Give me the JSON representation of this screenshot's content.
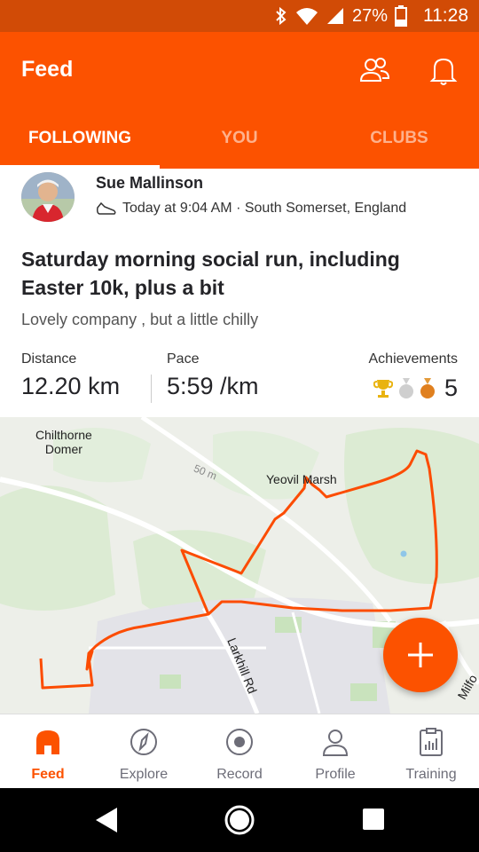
{
  "status_bar": {
    "battery_percent": "27%",
    "time": "11:28"
  },
  "header": {
    "title": "Feed"
  },
  "tabs": [
    {
      "label": "FOLLOWING",
      "active": true
    },
    {
      "label": "YOU",
      "active": false
    },
    {
      "label": "CLUBS",
      "active": false
    }
  ],
  "activity": {
    "athlete_name": "Sue Mallinson",
    "meta": "Today at 9:04 AM · South Somerset, England",
    "title": "Saturday morning social run, including Easter 10k, plus a bit",
    "description": "Lovely company , but a little chilly",
    "stats": {
      "distance_label": "Distance",
      "distance_value": "12.20 km",
      "pace_label": "Pace",
      "pace_value": "5:59 /km",
      "achievements_label": "Achievements",
      "achievements_count": "5"
    }
  },
  "map": {
    "labels": {
      "chilthorne": "Chilthorne\nDomer",
      "yeovil_marsh": "Yeovil Marsh",
      "contour": "50 m",
      "larkhill": "Larkhill Rd",
      "milford": "Milfo"
    },
    "route_color": "#fc4c02"
  },
  "bottom_nav": [
    {
      "label": "Feed",
      "icon": "home-icon",
      "active": true
    },
    {
      "label": "Explore",
      "icon": "compass-icon",
      "active": false
    },
    {
      "label": "Record",
      "icon": "record-icon",
      "active": false
    },
    {
      "label": "Profile",
      "icon": "profile-icon",
      "active": false
    },
    {
      "label": "Training",
      "icon": "training-icon",
      "active": false
    }
  ],
  "colors": {
    "brand": "#fc5200",
    "status_bar": "#d14b06"
  }
}
